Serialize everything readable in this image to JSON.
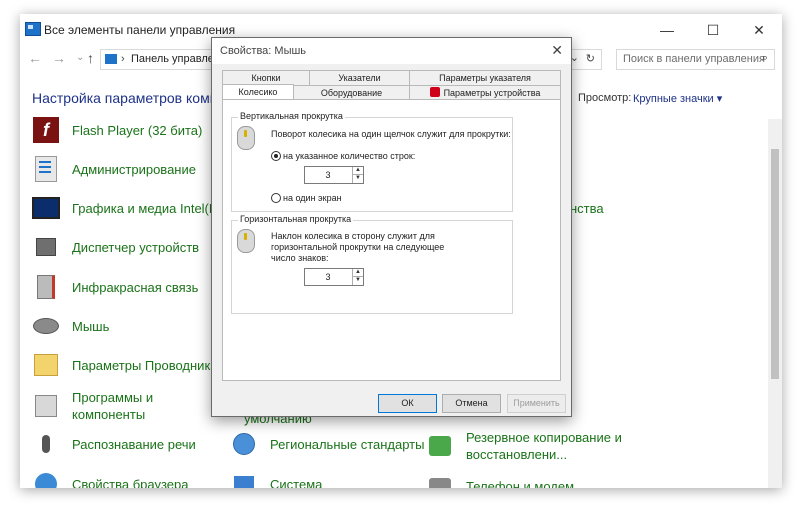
{
  "window": {
    "title": "Все элементы панели управления",
    "minimize": "—",
    "maximize": "☐",
    "close": "✕"
  },
  "address": {
    "path": "Панель управлен",
    "search_placeholder": "Поиск в панели управления"
  },
  "header": {
    "heading": "Настройка параметров компь",
    "view_label": "Просмотр:",
    "view_value": "Крупные значки ▾"
  },
  "items": [
    {
      "label": "Flash Player (32 бита)",
      "icon": "flash-icon"
    },
    {
      "label": "Администрирование",
      "icon": "admin-tools-icon"
    },
    {
      "label": "Графика и медиа Intel(R)",
      "icon": "monitor-icon"
    },
    {
      "label": "Диспетчер устройств",
      "icon": "device-manager-icon"
    },
    {
      "label": "Инфракрасная связь",
      "icon": "infrared-icon"
    },
    {
      "label": "Мышь",
      "icon": "mouse-icon"
    },
    {
      "label": "Параметры Проводника",
      "icon": "folder-icon"
    },
    {
      "label": "Программы и компоненты",
      "icon": "programs-icon"
    },
    {
      "label": "Распознавание речи",
      "icon": "microphone-icon"
    },
    {
      "label": "Свойства браузера",
      "icon": "browser-icon"
    }
  ],
  "items_col2": [
    {
      "label": "умолчанию"
    },
    {
      "label": "Региональные стандарты",
      "icon": "globe-clock-icon"
    },
    {
      "label": "Система",
      "icon": "system-icon"
    }
  ],
  "items_col3": [
    {
      "label": "нства"
    },
    {
      "label": "Резервное копирование и восстановлени...",
      "icon": "backup-icon"
    },
    {
      "label": "Телефон и модем",
      "icon": "phone-icon"
    }
  ],
  "dialog": {
    "title": "Свойства: Мышь",
    "close": "✕",
    "tabs_row1": [
      "Кнопки",
      "Указатели",
      "Параметры указателя"
    ],
    "tabs_row2": [
      "Колесико",
      "Оборудование",
      "Параметры устройства"
    ],
    "vertical": {
      "group_label": "Вертикальная прокрутка",
      "description": "Поворот колесика на один щелчок служит для прокрутки:",
      "option_lines": "на указанное количество строк:",
      "lines_value": "3",
      "option_screen": "на один экран"
    },
    "horizontal": {
      "group_label": "Горизонтальная прокрутка",
      "description_1": "Наклон колесика в сторону служит для",
      "description_2": "горизонтальной прокрутки на следующее",
      "description_3": "число знаков:",
      "chars_value": "3"
    },
    "buttons": {
      "ok": "ОК",
      "cancel": "Отмена",
      "apply": "Применить"
    }
  }
}
